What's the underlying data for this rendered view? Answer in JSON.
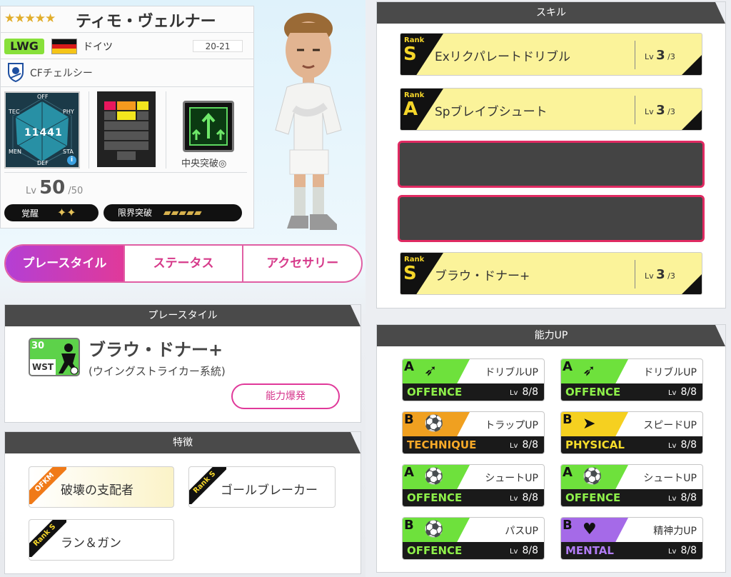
{
  "profile": {
    "stars": "★★★★★",
    "name": "ティモ・ヴェルナー",
    "position": "LWG",
    "country": "ドイツ",
    "season": "20-21",
    "club": "CFチェルシー",
    "overall": "11441",
    "radar_labels": {
      "off": "OFF",
      "tec": "TEC",
      "phy": "PHY",
      "men": "MEN",
      "sta": "STA",
      "def": "DEF"
    },
    "tactic_label": "中央突破◎",
    "level_prefix": "Lv",
    "level": "50",
    "level_max": "/50",
    "awakening_label": "覚醒",
    "awakening_marks": "✦✦",
    "limit_label": "限界突破",
    "limit_marks": "▰▰▰▰▰"
  },
  "tabs": [
    {
      "label": "プレースタイル",
      "active": true
    },
    {
      "label": "ステータス",
      "active": false
    },
    {
      "label": "アクセサリー",
      "active": false
    }
  ],
  "playstyle": {
    "header": "プレースタイル",
    "icon_level": "30",
    "icon_pos": "WST",
    "name": "ブラウ・ドナー+",
    "subtitle": "(ウイングストライカー系統)",
    "button": "能力爆発"
  },
  "traits": {
    "header": "特徴",
    "items": [
      {
        "badge": "OFKM",
        "name": "破壊の支配者"
      },
      {
        "badge": "Rank S",
        "name": "ゴールブレーカー"
      },
      {
        "badge": "Rank S",
        "name": "ラン＆ガン"
      }
    ]
  },
  "skills": {
    "header": "スキル",
    "rank_word": "Rank",
    "lv_word": "Lv",
    "items": [
      {
        "rank": "S",
        "name": "Exリクパレートドリブル",
        "level": "3",
        "max": "/3"
      },
      {
        "rank": "A",
        "name": "Spブレイブシュート",
        "level": "3",
        "max": "/3"
      },
      {
        "rank": "S",
        "name": "ブラウ・ドナー+",
        "level": "3",
        "max": "/3"
      }
    ]
  },
  "abilities": {
    "header": "能力UP",
    "lv_word": "Lv",
    "items": [
      {
        "grade": "A",
        "name": "ドリブルUP",
        "category": "OFFENCE",
        "level": "8/8",
        "color": "#6ee13c",
        "text_color": "#8ef04a",
        "glyph": "➶"
      },
      {
        "grade": "A",
        "name": "ドリブルUP",
        "category": "OFFENCE",
        "level": "8/8",
        "color": "#6ee13c",
        "text_color": "#8ef04a",
        "glyph": "➶"
      },
      {
        "grade": "B",
        "name": "トラップUP",
        "category": "TECHNIQUE",
        "level": "8/8",
        "color": "#f0a020",
        "text_color": "#f7a928",
        "glyph": "⚽"
      },
      {
        "grade": "B",
        "name": "スピードUP",
        "category": "PHYSICAL",
        "level": "8/8",
        "color": "#f5d020",
        "text_color": "#f5dc2a",
        "glyph": "➤"
      },
      {
        "grade": "A",
        "name": "シュートUP",
        "category": "OFFENCE",
        "level": "8/8",
        "color": "#6ee13c",
        "text_color": "#8ef04a",
        "glyph": "⚽"
      },
      {
        "grade": "A",
        "name": "シュートUP",
        "category": "OFFENCE",
        "level": "8/8",
        "color": "#6ee13c",
        "text_color": "#8ef04a",
        "glyph": "⚽"
      },
      {
        "grade": "B",
        "name": "パスUP",
        "category": "OFFENCE",
        "level": "8/8",
        "color": "#6ee13c",
        "text_color": "#8ef04a",
        "glyph": "⚽"
      },
      {
        "grade": "B",
        "name": "精神力UP",
        "category": "MENTAL",
        "level": "8/8",
        "color": "#a56ae8",
        "text_color": "#b17cf5",
        "glyph": "♥"
      }
    ]
  }
}
